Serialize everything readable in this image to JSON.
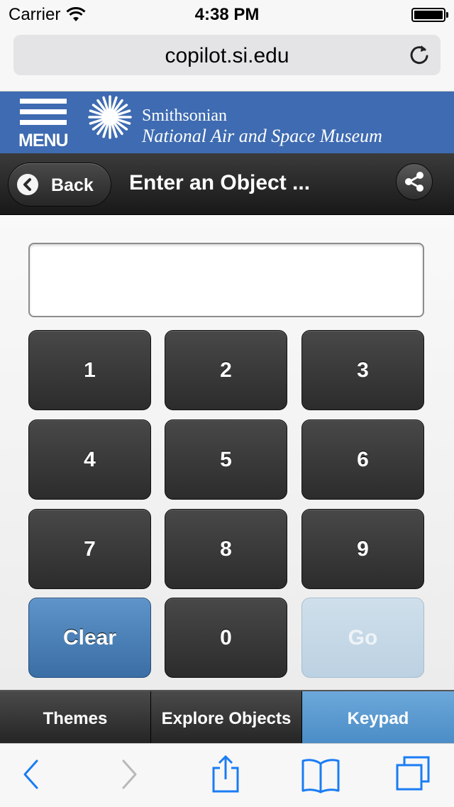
{
  "status_bar": {
    "carrier": "Carrier",
    "time": "4:38 PM",
    "battery_level": 1.0
  },
  "browser": {
    "url": "copilot.si.edu"
  },
  "site_header": {
    "menu_label": "MENU",
    "museum_line1": "Smithsonian",
    "museum_line2": "National Air and Space Museum",
    "brand_color": "#3e6bb1"
  },
  "toolbar": {
    "back_label": "Back",
    "title": "Enter an Object ..."
  },
  "keypad": {
    "entry_value": "",
    "keys": [
      "1",
      "2",
      "3",
      "4",
      "5",
      "6",
      "7",
      "8",
      "9"
    ],
    "clear_label": "Clear",
    "zero_label": "0",
    "go_label": "Go"
  },
  "tabs": [
    {
      "label": "Themes",
      "active": false
    },
    {
      "label": "Explore Objects",
      "active": false
    },
    {
      "label": "Keypad",
      "active": true
    }
  ],
  "icons": {
    "wifi": "wifi-icon",
    "battery": "battery-icon",
    "reload": "reload-icon",
    "back": "chevron-left-icon",
    "share": "share-icon",
    "nav_back": "chevron-left-icon",
    "nav_forward": "chevron-right-icon",
    "share_sheet": "share-sheet-icon",
    "bookmarks": "bookmarks-icon",
    "tabs": "tabs-icon"
  }
}
